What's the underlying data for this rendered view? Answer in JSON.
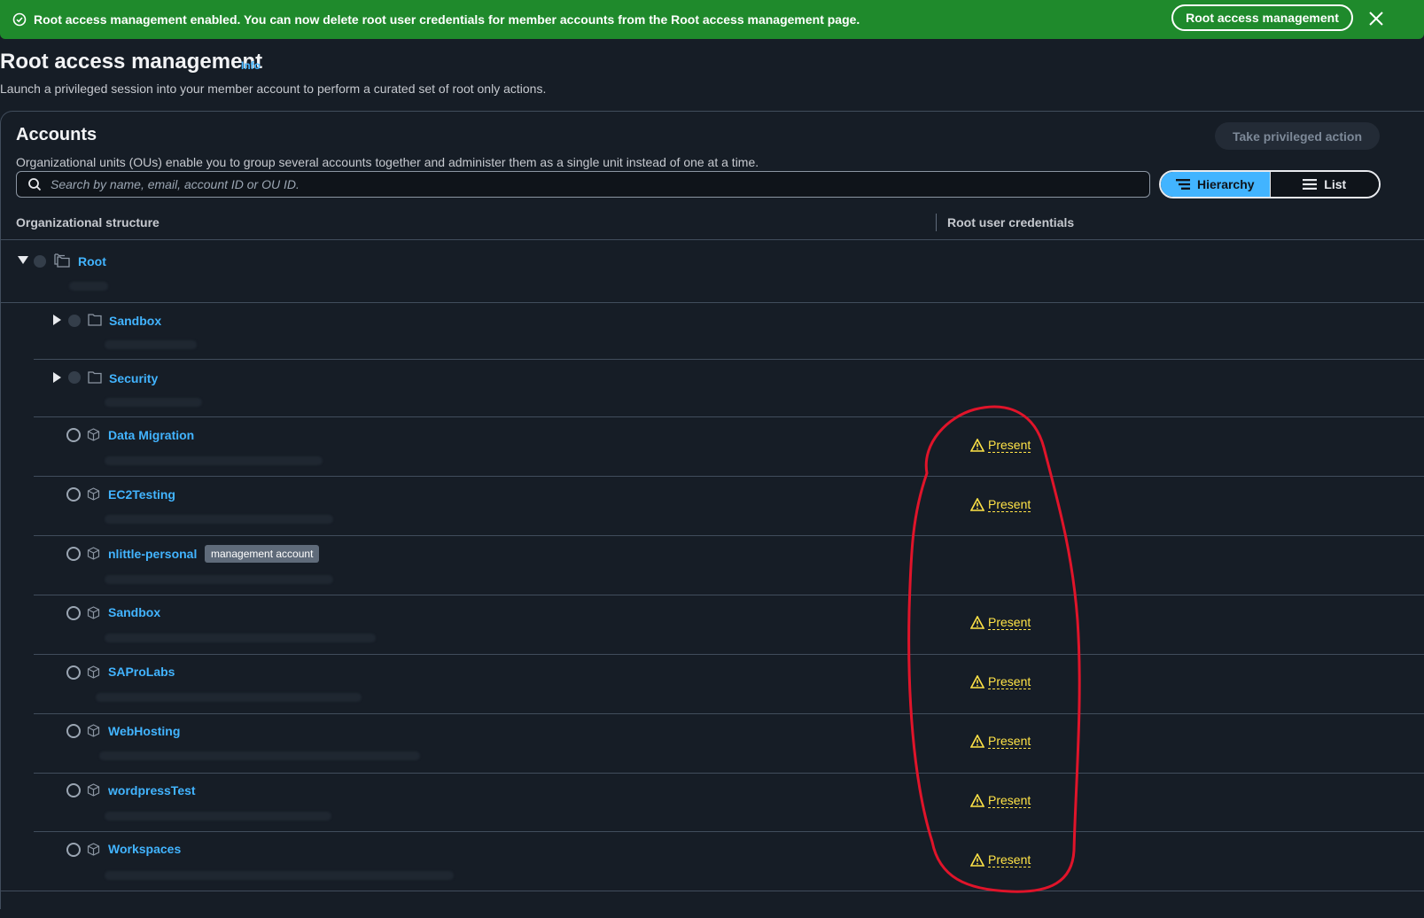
{
  "banner": {
    "message": "Root access management enabled. You can now delete root user credentials for member accounts from the Root access management page.",
    "button_label": "Root access management",
    "color": "#1f8a2c"
  },
  "page": {
    "title": "Root access management",
    "info_label": "Info",
    "description": "Launch a privileged session into your member account to perform a curated set of root only actions."
  },
  "accounts": {
    "title": "Accounts",
    "description": "Organizational units (OUs) enable you to group several accounts together and administer them as a single unit instead of one at a time.",
    "take_action_label": "Take privileged action",
    "search_placeholder": "Search by name, email, account ID or OU ID.",
    "view_toggle": {
      "hierarchy_label": "Hierarchy",
      "list_label": "List",
      "selected": "Hierarchy"
    },
    "columns": {
      "structure": "Organizational structure",
      "credentials": "Root user credentials"
    },
    "root": {
      "name": "Root"
    },
    "ous": [
      {
        "name": "Sandbox"
      },
      {
        "name": "Security"
      }
    ],
    "members": [
      {
        "name": "Data Migration",
        "credentials": "Present"
      },
      {
        "name": "EC2Testing",
        "credentials": "Present"
      },
      {
        "name": "nlittle-personal",
        "badge": "management account",
        "credentials": ""
      },
      {
        "name": "Sandbox",
        "credentials": "Present"
      },
      {
        "name": "SAProLabs",
        "credentials": "Present"
      },
      {
        "name": "WebHosting",
        "credentials": "Present"
      },
      {
        "name": "wordpressTest",
        "credentials": "Present"
      },
      {
        "name": "Workspaces",
        "credentials": "Present"
      }
    ]
  },
  "colors": {
    "link": "#42b4ff",
    "warning": "#ffe347",
    "annotation": "#e0142a"
  }
}
